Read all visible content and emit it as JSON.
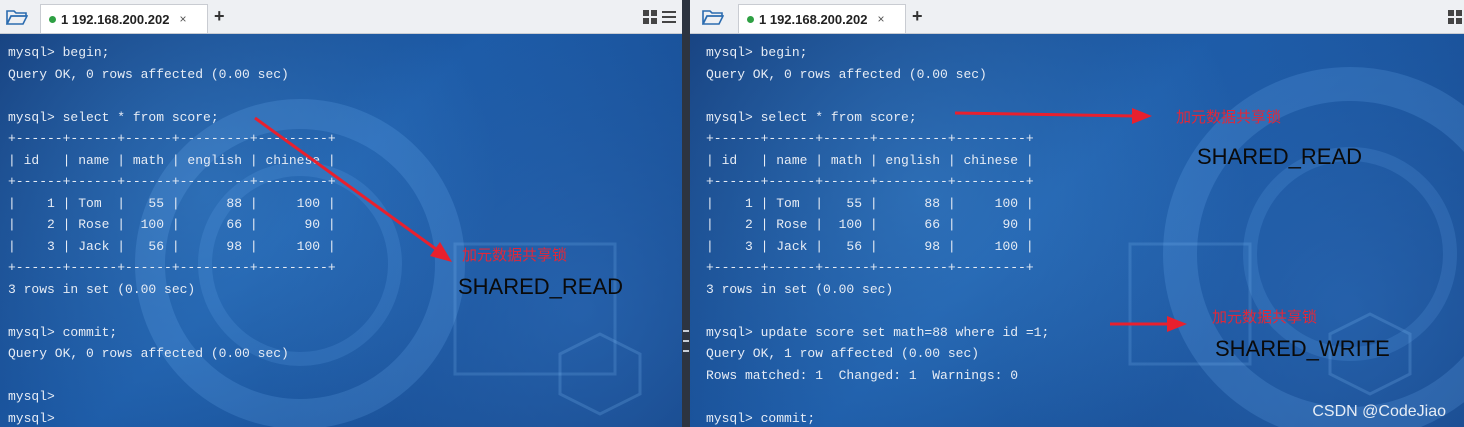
{
  "left": {
    "tab_title": "1 192.168.200.202",
    "tab_close": "×",
    "new_tab": "+",
    "lines": [
      "mysql> begin;",
      "Query OK, 0 rows affected (0.00 sec)",
      "",
      "mysql> select * from score;",
      "+------+------+------+---------+---------+",
      "| id   | name | math | english | chinese |",
      "+------+------+------+---------+---------+",
      "|    1 | Tom  |   55 |      88 |     100 |",
      "|    2 | Rose |  100 |      66 |      90 |",
      "|    3 | Jack |   56 |      98 |     100 |",
      "+------+------+------+---------+---------+",
      "3 rows in set (0.00 sec)",
      "",
      "mysql> commit;",
      "Query OK, 0 rows affected (0.00 sec)",
      "",
      "mysql>",
      "mysql>"
    ],
    "annotation_cn": "加元数据共享锁",
    "annotation_en": "SHARED_READ"
  },
  "right": {
    "tab_title": "1 192.168.200.202",
    "tab_close": "×",
    "new_tab": "+",
    "lines": [
      "mysql> begin;",
      "Query OK, 0 rows affected (0.00 sec)",
      "",
      "mysql> select * from score;",
      "+------+------+------+---------+---------+",
      "| id   | name | math | english | chinese |",
      "+------+------+------+---------+---------+",
      "|    1 | Tom  |   55 |      88 |     100 |",
      "|    2 | Rose |  100 |      66 |      90 |",
      "|    3 | Jack |   56 |      98 |     100 |",
      "+------+------+------+---------+---------+",
      "3 rows in set (0.00 sec)",
      "",
      "mysql> update score set math=88 where id =1;",
      "Query OK, 1 row affected (0.00 sec)",
      "Rows matched: 1  Changed: 1  Warnings: 0",
      "",
      "mysql> commit;"
    ],
    "annotation1_cn": "加元数据共享锁",
    "annotation1_en": "SHARED_READ",
    "annotation2_cn": "加元数据共享锁",
    "annotation2_en": "SHARED_WRITE"
  },
  "watermark": "CSDN @CodeJiao",
  "colors": {
    "annotation_red": "#e0283a",
    "arrow_red": "#e8202e",
    "status_green": "#2ea043"
  }
}
